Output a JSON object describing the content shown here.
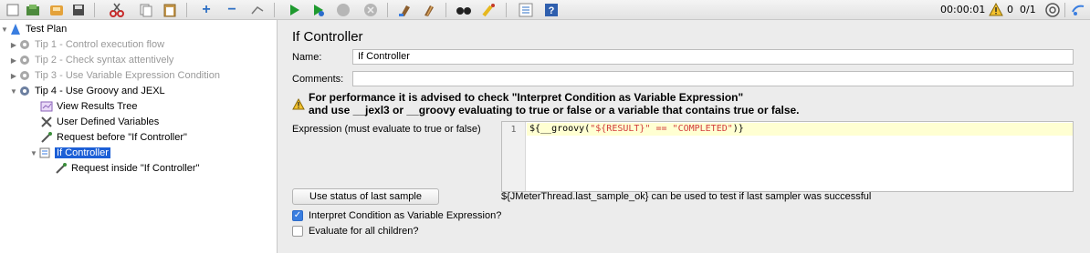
{
  "toolbar": {
    "icons": [
      "templates-icon",
      "open-icon",
      "save-icon",
      "cut-icon",
      "copy-icon",
      "paste-icon",
      "expand-icon",
      "collapse-icon",
      "toggle-icon",
      "start-icon",
      "start-no-pause-icon",
      "stop-icon",
      "shutdown-icon",
      "clear-icon",
      "clear-all-icon",
      "search-icon",
      "reset-search-icon",
      "function-helper-icon",
      "help-icon"
    ],
    "elapsed": "00:00:01",
    "warnings": "0",
    "threads": "0/1"
  },
  "tree": {
    "items": [
      {
        "label": "Test Plan",
        "icon": "test-plan-icon",
        "expanded": true,
        "disabled": false,
        "selected": false
      },
      {
        "label": "Tip 1 - Control execution flow",
        "icon": "gear-icon",
        "expanded": false,
        "disabled": true,
        "selected": false
      },
      {
        "label": "Tip 2 - Check syntax attentively",
        "icon": "gear-icon",
        "expanded": false,
        "disabled": true,
        "selected": false
      },
      {
        "label": "Tip 3 - Use Variable Expression Condition",
        "icon": "gear-icon",
        "expanded": false,
        "disabled": true,
        "selected": false
      },
      {
        "label": "Tip 4 - Use Groovy and JEXL",
        "icon": "gear-icon",
        "expanded": true,
        "disabled": false,
        "selected": false
      },
      {
        "label": "View Results Tree",
        "icon": "listener-icon",
        "expanded": false,
        "disabled": false,
        "selected": false
      },
      {
        "label": "User Defined Variables",
        "icon": "config-icon",
        "expanded": false,
        "disabled": false,
        "selected": false
      },
      {
        "label": "Request before \"If Controller\"",
        "icon": "sampler-icon",
        "expanded": false,
        "disabled": false,
        "selected": false
      },
      {
        "label": "If Controller",
        "icon": "controller-icon",
        "expanded": true,
        "disabled": false,
        "selected": true
      },
      {
        "label": "Request inside \"If Controller\"",
        "icon": "sampler-icon",
        "expanded": false,
        "disabled": false,
        "selected": false
      }
    ]
  },
  "panel": {
    "title": "If Controller",
    "name_label": "Name:",
    "name_value": "If Controller",
    "comments_label": "Comments:",
    "comments_value": "",
    "warning_line1": "For performance it is advised to check \"Interpret Condition as Variable Expression\"",
    "warning_line2": "and use __jexl3 or __groovy evaluating to true or false or a variable that contains true or false.",
    "expression_label": "Expression (must evaluate to true or false)",
    "line_number": "1",
    "code_prefix": "${__groovy(",
    "code_string": "\"${RESULT}\" == \"COMPLETED\"",
    "code_suffix": ")}",
    "last_sample_button": "Use status of last sample",
    "last_sample_hint": "${JMeterThread.last_sample_ok} can be used to test if last sampler was successful",
    "interpret_label": "Interpret Condition as Variable Expression?",
    "interpret_checked": true,
    "evaluate_all_label": "Evaluate for all children?",
    "evaluate_all_checked": false
  }
}
